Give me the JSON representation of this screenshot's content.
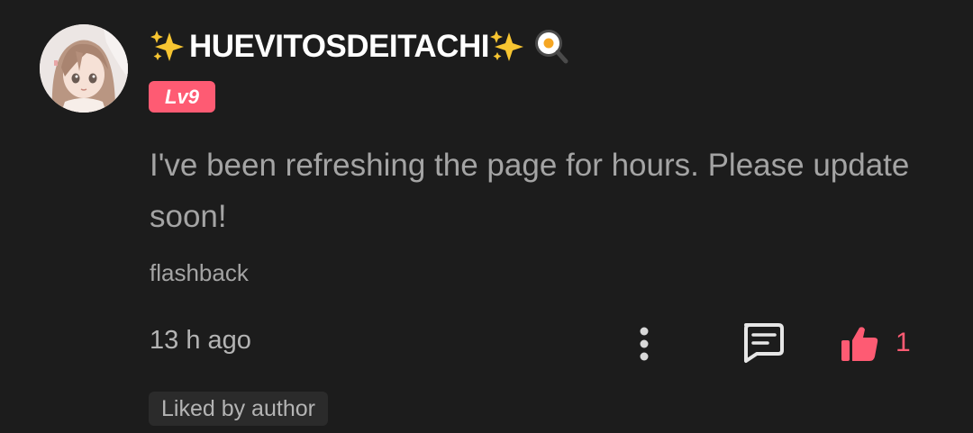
{
  "comment": {
    "avatar_icon": "anime-girl-avatar",
    "username": "HUEVITOSDEITACHI",
    "username_prefix_icon": "sparkles-icon",
    "username_suffix_icon": "sparkles-icon",
    "username_trailing_icon": "frying-pan-egg-icon",
    "level_badge": "Lv9",
    "text": "I've been refreshing the page for hours. Please update soon!",
    "chapter_tag": "flashback",
    "timestamp": "13 h ago",
    "actions": {
      "more_icon": "more-vertical-icon",
      "reply_icon": "comment-reply-icon",
      "like_icon": "thumbs-up-icon",
      "like_count": "1"
    },
    "liked_by_author": "Liked by author"
  },
  "colors": {
    "background": "#1c1c1c",
    "accent": "#fe5b73",
    "text_secondary": "#a4a4a4"
  }
}
